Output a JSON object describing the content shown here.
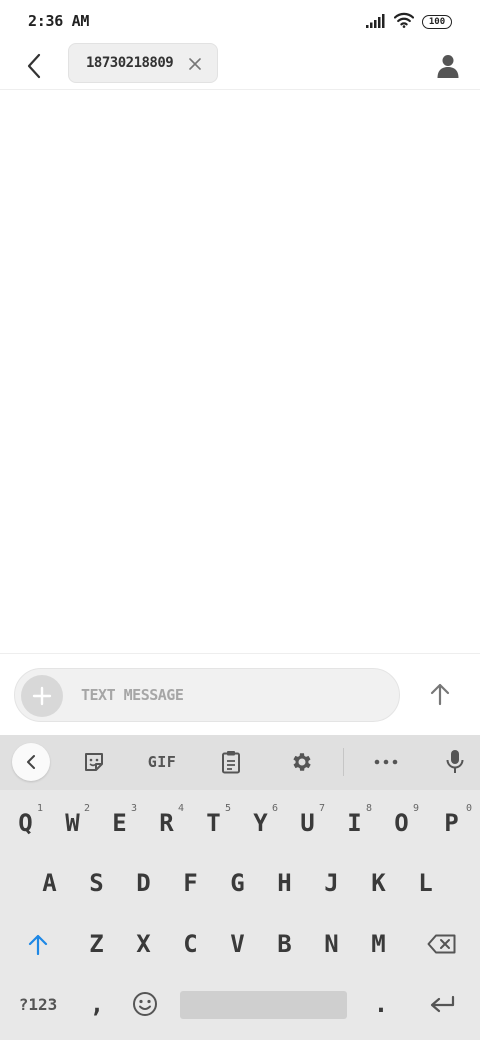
{
  "status_bar": {
    "time": "2:36 AM",
    "battery": "100",
    "icons": [
      "signal-icon",
      "wifi-icon",
      "battery-icon"
    ]
  },
  "header": {
    "back_icon": "back-arrow-icon",
    "recipient": "18730218809",
    "remove_icon": "close-icon",
    "contact_icon": "person-icon"
  },
  "compose": {
    "add_icon": "plus-icon",
    "placeholder": "TEXT MESSAGE",
    "value": "",
    "send_icon": "send-arrow-icon"
  },
  "keyboard": {
    "toolbar": {
      "items": [
        "back-icon",
        "sticker-icon",
        "gif",
        "clipboard-icon",
        "settings-icon",
        "more-icon",
        "mic-icon"
      ],
      "gif_label": "GIF"
    },
    "row1": [
      {
        "key": "Q",
        "hint": "1"
      },
      {
        "key": "W",
        "hint": "2"
      },
      {
        "key": "E",
        "hint": "3"
      },
      {
        "key": "R",
        "hint": "4"
      },
      {
        "key": "T",
        "hint": "5"
      },
      {
        "key": "Y",
        "hint": "6"
      },
      {
        "key": "U",
        "hint": "7"
      },
      {
        "key": "I",
        "hint": "8"
      },
      {
        "key": "O",
        "hint": "9"
      },
      {
        "key": "P",
        "hint": "0"
      }
    ],
    "row2": [
      "A",
      "S",
      "D",
      "F",
      "G",
      "H",
      "J",
      "K",
      "L"
    ],
    "row3": [
      "Z",
      "X",
      "C",
      "V",
      "B",
      "N",
      "M"
    ],
    "row4": {
      "symbols": "?123",
      "comma": ",",
      "period": "."
    },
    "accent_color": "#1e88e5"
  }
}
